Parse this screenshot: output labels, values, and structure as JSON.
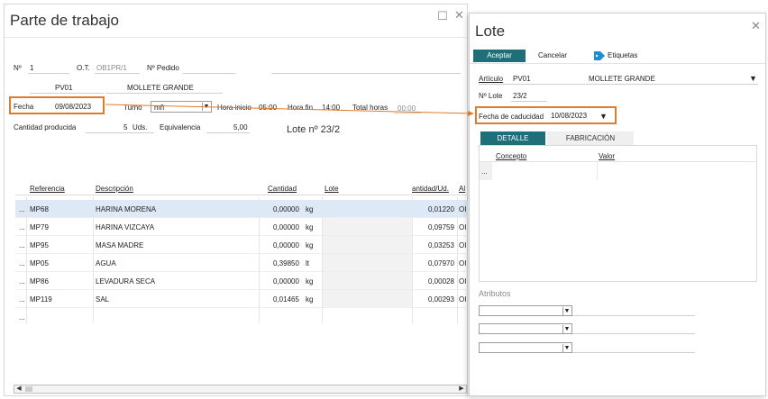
{
  "parte": {
    "title": "Parte de trabajo",
    "no_label": "Nº",
    "no_value": "1",
    "ot_label": "O.T.",
    "ot_value": "OB1PR/1",
    "pedido_label": "Nº Pedido",
    "articulo_code": "PV01",
    "articulo_name": "MOLLETE GRANDE",
    "fecha_label": "Fecha",
    "fecha_value": "09/08/2023",
    "turno_label": "Turno",
    "turno_value": "mñ",
    "hora_inicio_label": "Hora inicio",
    "hora_inicio_value": "05:00",
    "hora_fin_label": "Hora fin",
    "hora_fin_value": "14:00",
    "total_horas_label": "Total horas",
    "total_horas_value": "00:00",
    "cantidad_label": "Cantidad producida",
    "cantidad_value": "5",
    "cantidad_unit": "Uds.",
    "equivalencia_label": "Equivalencia",
    "equivalencia_value": "5,00",
    "lote_text": "Lote nº 23/2"
  },
  "grid": {
    "headers": {
      "referencia": "Referencia",
      "descripcion": "Descripción",
      "cantidad": "Cantidad",
      "lote": "Lote",
      "cant_ud": "antidad/Ud.",
      "alm": "Al"
    },
    "rows": [
      {
        "ref": "MP68",
        "desc": "HARINA MORENA",
        "cant": "0,00000",
        "unit": "kg",
        "cud": "0,01220",
        "alm": "OI"
      },
      {
        "ref": "MP79",
        "desc": "HARINA VIZCAYA",
        "cant": "0,00000",
        "unit": "kg",
        "cud": "0,09759",
        "alm": "OI"
      },
      {
        "ref": "MP95",
        "desc": "MASA MADRE",
        "cant": "0,00000",
        "unit": "kg",
        "cud": "0,03253",
        "alm": "OI"
      },
      {
        "ref": "MP05",
        "desc": "AGUA",
        "cant": "0,39850",
        "unit": "lt",
        "cud": "0,07970",
        "alm": "OI"
      },
      {
        "ref": "MP86",
        "desc": "LEVADURA SECA",
        "cant": "0,00000",
        "unit": "kg",
        "cud": "0,00028",
        "alm": "OI"
      },
      {
        "ref": "MP119",
        "desc": "SAL",
        "cant": "0,01465",
        "unit": "kg",
        "cud": "0,00293",
        "alm": "OI"
      }
    ],
    "row_marker": "...",
    "empty_marker": "..."
  },
  "lote": {
    "title": "Lote",
    "aceptar": "Aceptar",
    "cancelar": "Cancelar",
    "etiquetas": "Etiquetas",
    "articulo_label": "Artículo",
    "articulo_code": "PV01",
    "articulo_name": "MOLLETE GRANDE",
    "nlote_label": "Nº Lote",
    "nlote_value": "23/2",
    "caducidad_label": "Fecha de caducidad",
    "caducidad_value": "10/08/2023",
    "tabs": [
      "DETALLE",
      "FABRICACIÓN"
    ],
    "concepto_header": "Concepto",
    "valor_header": "Valor",
    "row_marker": "...",
    "atributos_label": "Atributos"
  },
  "colors": {
    "accent": "#1f6f78",
    "highlight": "#e07b2b",
    "selected_row": "#dde9f6"
  },
  "icons": {
    "tag": "tag-icon",
    "close": "close-icon",
    "maximize": "maximize-icon",
    "dropdown": "chevron-down-icon"
  }
}
